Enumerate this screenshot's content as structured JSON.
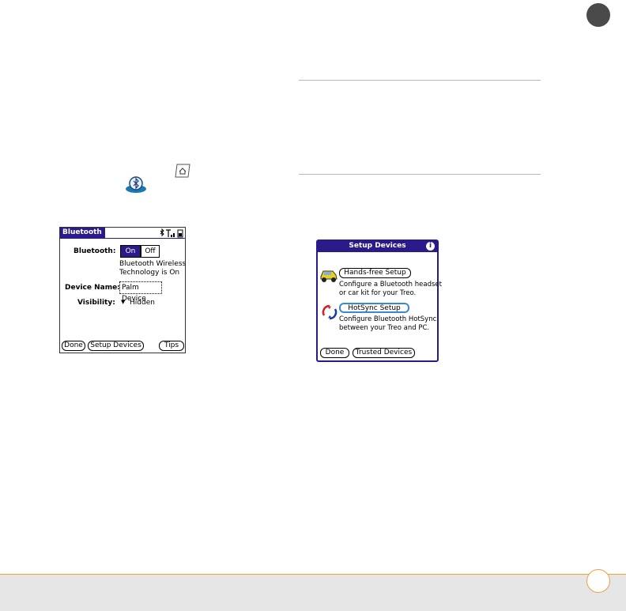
{
  "bluetooth_screen": {
    "title": "Bluetooth",
    "bluetooth_label": "Bluetooth:",
    "on": "On",
    "off": "Off",
    "status_line1": "Bluetooth Wireless",
    "status_line2": "Technology is On",
    "device_name_label": "Device Name:",
    "device_name_value": "Palm Device",
    "visibility_label": "Visibility:",
    "visibility_value": "Hidden",
    "done": "Done",
    "setup_devices": "Setup Devices",
    "tips": "Tips"
  },
  "setup_screen": {
    "title": "Setup Devices",
    "handsfree_button": "Hands-free Setup",
    "handsfree_desc1": "Configure a Bluetooth headset",
    "handsfree_desc2": "or car kit for your Treo.",
    "hotsync_button": "HotSync Setup",
    "hotsync_desc1": "Configure Bluetooth HotSync",
    "hotsync_desc2": "between your Treo and PC.",
    "done": "Done",
    "trusted_devices": "Trusted Devices"
  },
  "colors": {
    "accent": "#f0a040",
    "title_bar": "#2a1a8a",
    "chapter_circle": "#4a4a4a"
  }
}
